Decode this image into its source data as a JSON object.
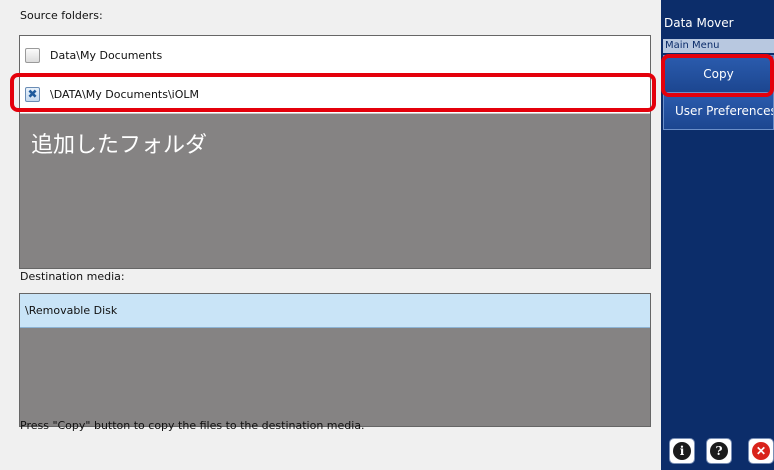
{
  "source": {
    "label": "Source folders:",
    "folders": [
      {
        "label": "Data\\My Documents",
        "checked": false
      },
      {
        "label": "\\DATA\\My Documents\\iOLM",
        "checked": true
      }
    ],
    "annotation": "追加したフォルダ"
  },
  "destination": {
    "label": "Destination media:",
    "items": [
      {
        "label": "\\Removable Disk",
        "selected": true
      }
    ]
  },
  "status_text": "Press \"Copy\" button to copy the files to the destination media.",
  "sidebar": {
    "title": "Data Mover",
    "subtitle": "Main Menu",
    "copy_label": "Copy",
    "prefs_label": "User Preferences...",
    "bottom_icons": [
      "info-icon",
      "help-icon",
      "close-icon"
    ]
  },
  "colors": {
    "highlight": "#e4000b",
    "sidebar_bg": "#0c2d6a",
    "button_bg": "#1c4690",
    "panel_bg": "#858383",
    "selected_row": "#c9e4f7"
  }
}
